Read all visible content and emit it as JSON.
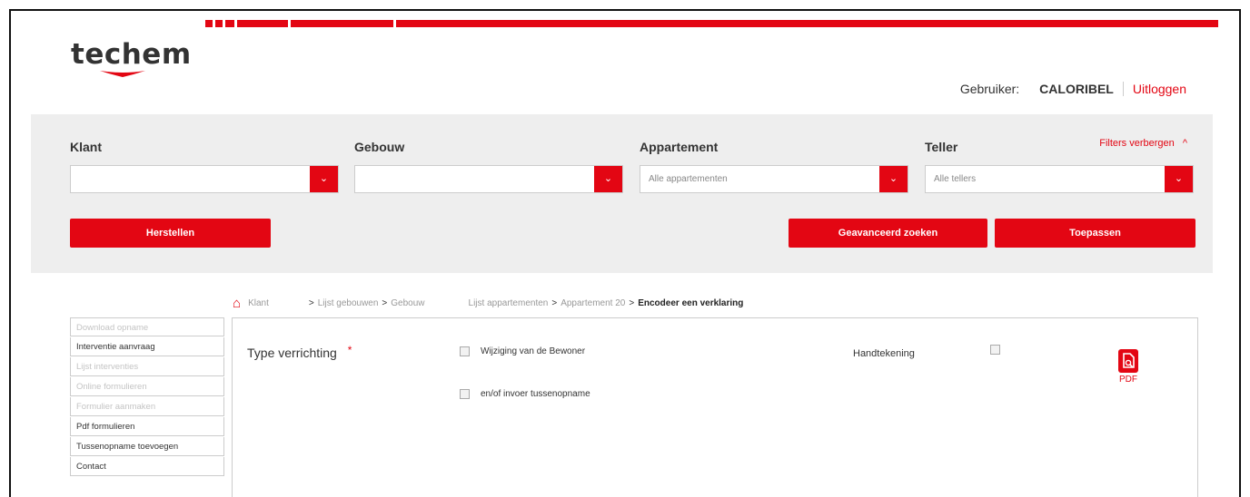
{
  "logo": {
    "text": "techem"
  },
  "user": {
    "label": "Gebruiker:",
    "name": "CALORIBEL",
    "logout": "Uitloggen"
  },
  "filters": {
    "klant": {
      "label": "Klant",
      "placeholder": ""
    },
    "gebouw": {
      "label": "Gebouw",
      "placeholder": ""
    },
    "appartement": {
      "label": "Appartement",
      "placeholder": "Alle appartementen"
    },
    "teller": {
      "label": "Teller",
      "placeholder": "Alle tellers"
    },
    "hide_label": "Filters verbergen",
    "reset_button": "Herstellen",
    "advanced_button": "Geavanceerd zoeken",
    "apply_button": "Toepassen"
  },
  "breadcrumb": {
    "klant": "Klant",
    "sep1": ">",
    "gebouwen": "Lijst gebouwen",
    "sep2": ">",
    "gebouw": "Gebouw",
    "appartementen": "Lijst appartementen",
    "sep3": ">",
    "appartement": "Appartement 20",
    "sep4": ">",
    "current": "Encodeer een verklaring"
  },
  "sidebar": {
    "items": [
      {
        "label": "Download opname",
        "enabled": false
      },
      {
        "label": "Interventie aanvraag",
        "enabled": true
      },
      {
        "label": "Lijst interventies",
        "enabled": false
      },
      {
        "label": "Online formulieren",
        "enabled": false
      },
      {
        "label": "Formulier aanmaken",
        "enabled": false
      },
      {
        "label": "Pdf formulieren",
        "enabled": true
      },
      {
        "label": "Tussenopname toevoegen",
        "enabled": true
      },
      {
        "label": "Contact",
        "enabled": true
      }
    ]
  },
  "form": {
    "type_label": "Type verrichting",
    "required_mark": "*",
    "option1": "Wijziging van de Bewoner",
    "option2": "en/of invoer tussenopname",
    "signature_label": "Handtekening",
    "pdf_label": "PDF"
  },
  "colors": {
    "accent": "#e30613",
    "panel": "#eeeeee"
  }
}
